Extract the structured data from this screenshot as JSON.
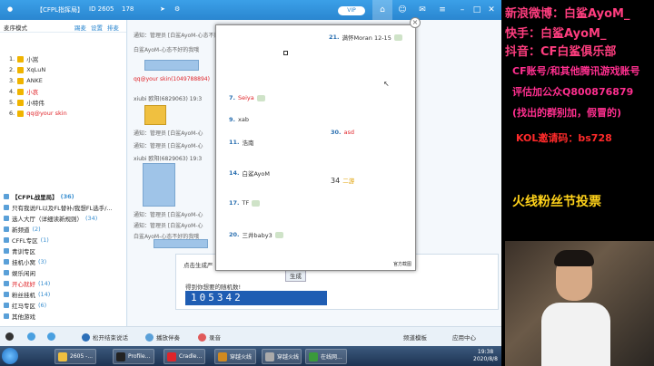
{
  "app": {
    "title": "【CFPL指挥局】",
    "channel_id": "ID 2605",
    "online_count": "178"
  },
  "members": {
    "mode_label": "麦序模式",
    "tabs": [
      "踢麦",
      "设置",
      "排麦"
    ],
    "list": [
      {
        "idx": "1.",
        "name": "小嵩",
        "color": "#333"
      },
      {
        "idx": "2.",
        "name": "XqLuN",
        "color": "#333"
      },
      {
        "idx": "3.",
        "name": "ANKE",
        "color": "#333"
      },
      {
        "idx": "4.",
        "name": "小哀",
        "color": "#e0252a"
      },
      {
        "idx": "5.",
        "name": "小特伟",
        "color": "#333"
      },
      {
        "idx": "6.",
        "name": "qq@your skin",
        "color": "#e0252a"
      }
    ]
  },
  "channels": [
    {
      "name": "【CFPL战里局】",
      "count": "(36)"
    },
    {
      "name": "只有我说FL以及FL替补/我想FL选手/...",
      "count": ""
    },
    {
      "name": "选人大厅（详细读新规则）",
      "count": "(34)"
    },
    {
      "name": "新频道",
      "count": "(2)"
    },
    {
      "name": "CFFL专区",
      "count": "(1)"
    },
    {
      "name": "青训专区",
      "count": ""
    },
    {
      "name": "挂机小窝",
      "count": "(3)"
    },
    {
      "name": "娱乐闲闲",
      "count": ""
    },
    {
      "name": "开心就好",
      "count": "(14)"
    },
    {
      "name": "粉丝挂机",
      "count": "(14)"
    },
    {
      "name": "红马专区",
      "count": "(6)"
    },
    {
      "name": "其他游戏",
      "count": ""
    }
  ],
  "chat": {
    "notices": [
      "通知：管理员 [白鲨AyoM-心态不好的我哦]",
      "白鲨AyoM-心态不好的我哦",
      "qq@your skin(1049788894)",
      "xiubi 欧阳(6829063) 19:3",
      "通知：管理员 [白鲨AyoM-心",
      "通知：管理员 [白鲨AyoM-心",
      "xiubi 欧阳(6829063) 19:3",
      "通知：管理员 [白鲨AyoM-心",
      "通知：管理员 [白鲨AyoM-心",
      "白鲨AyoM-心态不好的我哦"
    ]
  },
  "popup": {
    "entries": [
      {
        "num": "21.",
        "name": "满怀Moran 12-15"
      },
      {
        "num": "7.",
        "name": "Seiya"
      },
      {
        "num": "9.",
        "name": "xab"
      },
      {
        "num": "30.",
        "name": "asd"
      },
      {
        "num": "11.",
        "name": "浩南"
      },
      {
        "num": "14.",
        "name": "白鲨AyoM"
      },
      {
        "num": "17.",
        "name": "TF"
      },
      {
        "num": "20.",
        "name": "三井baby3"
      }
    ],
    "badge_num": "34",
    "badge_label": "二游",
    "footer": "官方截图"
  },
  "lottery": {
    "action": "点击生成严",
    "button": "生成",
    "result_label": "得到你想要的随机数!",
    "number": "105342"
  },
  "toolbar": {
    "items": [
      "松开结束说话",
      "播放伴奏",
      "录音"
    ],
    "right_items": [
      "频道模板",
      "应用中心"
    ]
  },
  "taskbar": {
    "tasks": [
      "2605 -...",
      "Profile...",
      "Cradle...",
      "穿越火线",
      "穿越火线",
      "在线网..."
    ],
    "time": "19:38",
    "date": "2020/8/8"
  },
  "overlay": {
    "weibo": "新浪微博：白鲨AyoM_",
    "kuaishou": "快手：白鲨AyoM_",
    "douyin": "抖音：CF白鲨俱乐部",
    "line1": "CF账号/和其他腾讯游戏账号",
    "line2": "评估加公众Q800876879",
    "line3": "(找出的群别加，假冒的)",
    "kol": "KOL邀请码：bs728",
    "vote": "火线粉丝节投票"
  }
}
